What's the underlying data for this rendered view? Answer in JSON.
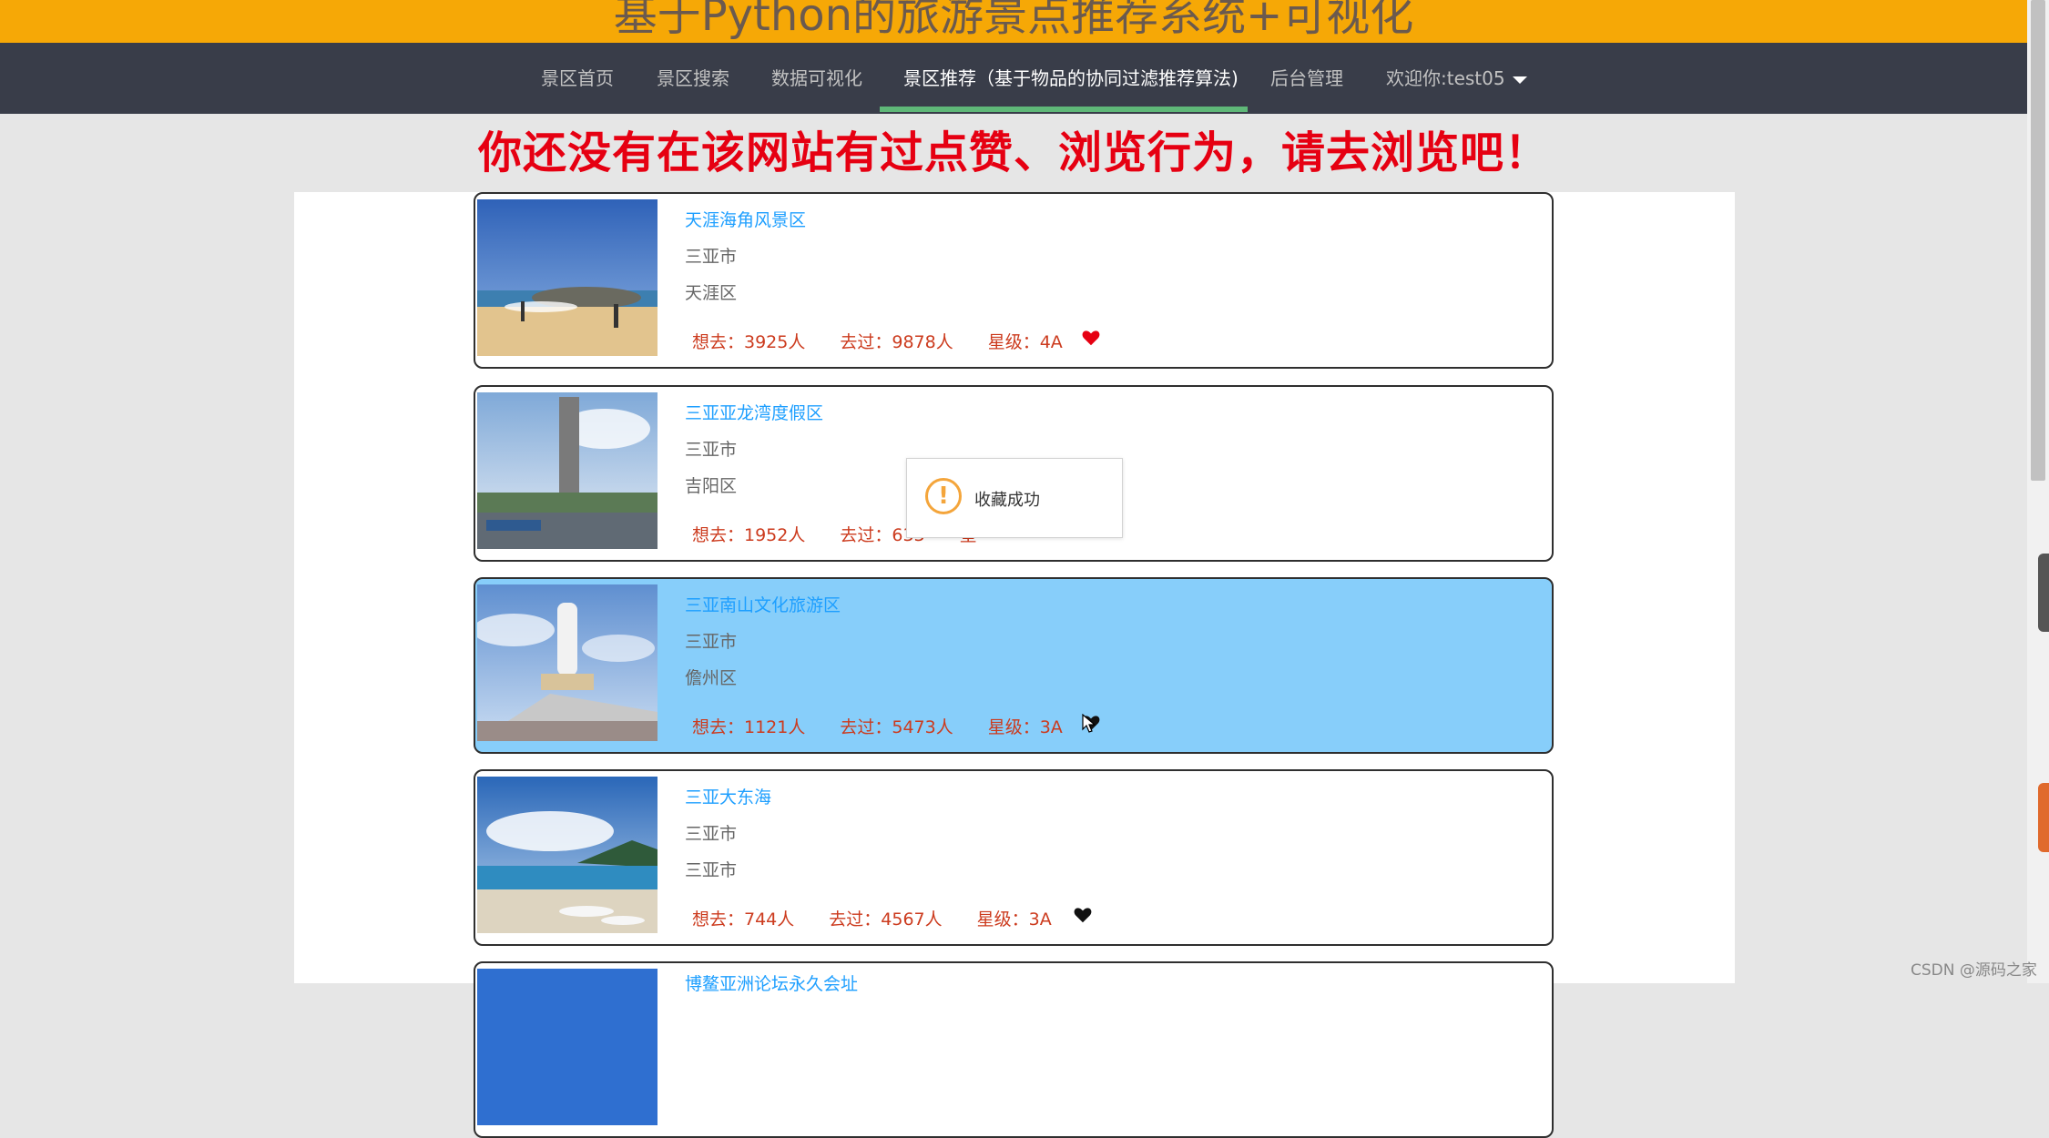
{
  "header": {
    "title": "基于Python的旅游景点推荐系统+可视化"
  },
  "nav": {
    "items": [
      {
        "label": "景区首页"
      },
      {
        "label": "景区搜索"
      },
      {
        "label": "数据可视化"
      },
      {
        "label": "景区推荐（基于物品的协同过滤推荐算法)"
      },
      {
        "label": "后台管理"
      }
    ],
    "active_index": 3,
    "user_label": "欢迎你:test05"
  },
  "notice": "你还没有在该网站有过点赞、浏览行为，请去浏览吧！",
  "cards": [
    {
      "name": "天涯海角风景区",
      "city": "三亚市",
      "district": "天涯区",
      "want": "想去：3925人",
      "visited": "去过：9878人",
      "level": "星级：4A",
      "favorited": true
    },
    {
      "name": "三亚亚龙湾度假区",
      "city": "三亚市",
      "district": "吉阳区",
      "want": "想去：1952人",
      "visited": "去过：633",
      "level": "星",
      "favorited": false
    },
    {
      "name": "三亚南山文化旅游区",
      "city": "三亚市",
      "district": "儋州区",
      "want": "想去：1121人",
      "visited": "去过：5473人",
      "level": "星级：3A",
      "favorited": false
    },
    {
      "name": "三亚大东海",
      "city": "三亚市",
      "district": "三亚市",
      "want": "想去：744人",
      "visited": "去过：4567人",
      "level": "星级：3A",
      "favorited": false
    },
    {
      "name": "博鳌亚洲论坛永久会址",
      "city": "",
      "district": "",
      "want": "",
      "visited": "",
      "level": "",
      "favorited": false
    }
  ],
  "toast": {
    "message": "收藏成功",
    "icon": "warning-icon"
  },
  "colors": {
    "brand": "#f6a806",
    "nav_bg": "#393d49",
    "active_indicator": "#5fb878",
    "title_link": "#1e9fff",
    "stat_text": "#cc3b1e",
    "highlight_row": "#87cefa",
    "notice": "#e60012"
  },
  "watermark": "CSDN @源码之家"
}
